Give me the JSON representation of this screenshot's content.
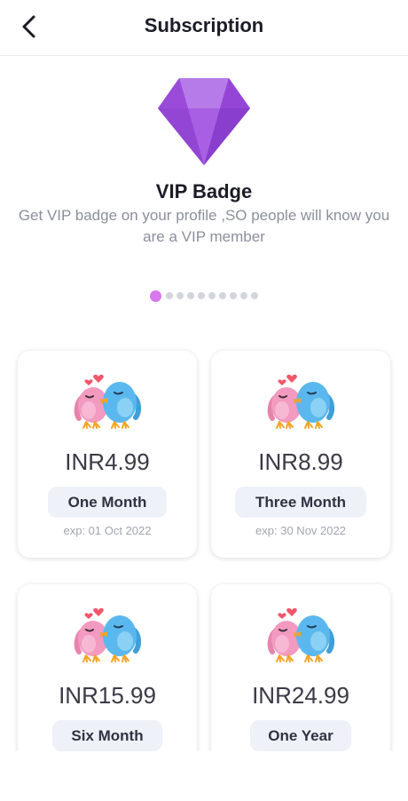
{
  "header": {
    "title": "Subscription"
  },
  "hero": {
    "icon": "diamond-icon",
    "title": "VIP Badge",
    "description": "Get VIP badge on your profile ,SO people will know you are a VIP member"
  },
  "pager": {
    "total": 10,
    "active_index": 0
  },
  "plans": [
    {
      "price": "INR4.99",
      "label": "One Month",
      "expiry": "exp: 01 Oct 2022"
    },
    {
      "price": "INR8.99",
      "label": "Three Month",
      "expiry": "exp: 30 Nov 2022"
    },
    {
      "price": "INR15.99",
      "label": "Six Month",
      "expiry": ""
    },
    {
      "price": "INR24.99",
      "label": "One Year",
      "expiry": ""
    }
  ],
  "colors": {
    "accent": "#d977ee",
    "diamond": "#a050e0",
    "pill_bg": "#eef1f8",
    "bird_pink": "#f29ac0",
    "bird_blue": "#5bb8ee"
  }
}
